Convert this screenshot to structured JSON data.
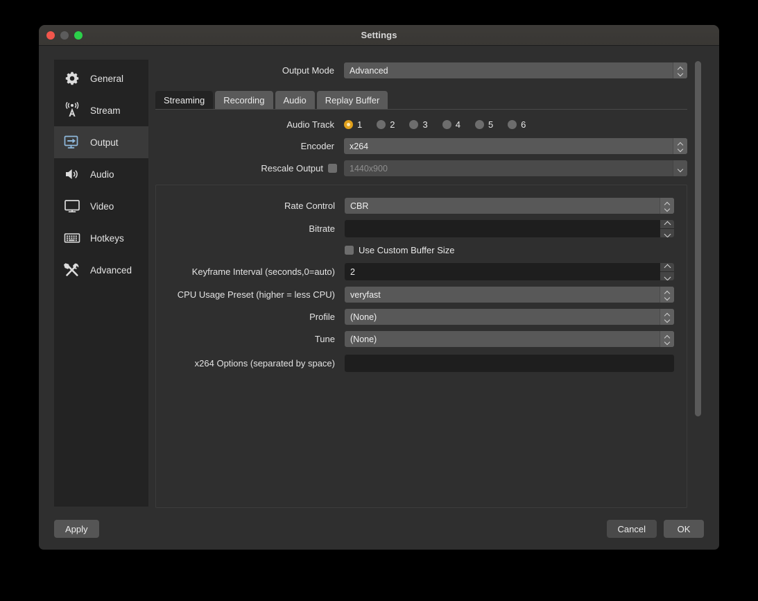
{
  "window": {
    "title": "Settings",
    "traffic_lights": [
      "close-red",
      "minimize-grey",
      "zoom-green"
    ]
  },
  "sidebar": {
    "items": [
      {
        "label": "General",
        "icon": "gear-icon",
        "selected": false
      },
      {
        "label": "Stream",
        "icon": "broadcast-icon",
        "selected": false
      },
      {
        "label": "Output",
        "icon": "monitor-arrow-icon",
        "selected": true
      },
      {
        "label": "Audio",
        "icon": "speaker-icon",
        "selected": false
      },
      {
        "label": "Video",
        "icon": "monitor-icon",
        "selected": false
      },
      {
        "label": "Hotkeys",
        "icon": "keyboard-icon",
        "selected": false
      },
      {
        "label": "Advanced",
        "icon": "tools-icon",
        "selected": false
      }
    ]
  },
  "output_mode": {
    "label": "Output Mode",
    "value": "Advanced"
  },
  "tabs": [
    {
      "label": "Streaming",
      "active": true
    },
    {
      "label": "Recording",
      "active": false
    },
    {
      "label": "Audio",
      "active": false
    },
    {
      "label": "Replay Buffer",
      "active": false
    }
  ],
  "streaming": {
    "audio_track": {
      "label": "Audio Track",
      "options": [
        "1",
        "2",
        "3",
        "4",
        "5",
        "6"
      ],
      "selected": "1",
      "selected_color": "#e0a01b"
    },
    "encoder": {
      "label": "Encoder",
      "value": "x264"
    },
    "rescale_output": {
      "label": "Rescale Output",
      "checked": false,
      "value": "1440x900",
      "enabled": false
    },
    "rate_control": {
      "label": "Rate Control",
      "value": "CBR"
    },
    "bitrate": {
      "label": "Bitrate",
      "value": ""
    },
    "use_custom_buffer_size": {
      "label": "Use Custom Buffer Size",
      "checked": false
    },
    "keyframe_interval": {
      "label": "Keyframe Interval (seconds,0=auto)",
      "value": "2"
    },
    "cpu_usage_preset": {
      "label": "CPU Usage Preset (higher = less CPU)",
      "value": "veryfast"
    },
    "profile": {
      "label": "Profile",
      "value": "(None)"
    },
    "tune": {
      "label": "Tune",
      "value": "(None)"
    },
    "x264_options": {
      "label": "x264 Options (separated by space)",
      "value": ""
    }
  },
  "footer": {
    "apply": "Apply",
    "cancel": "Cancel",
    "ok": "OK"
  }
}
